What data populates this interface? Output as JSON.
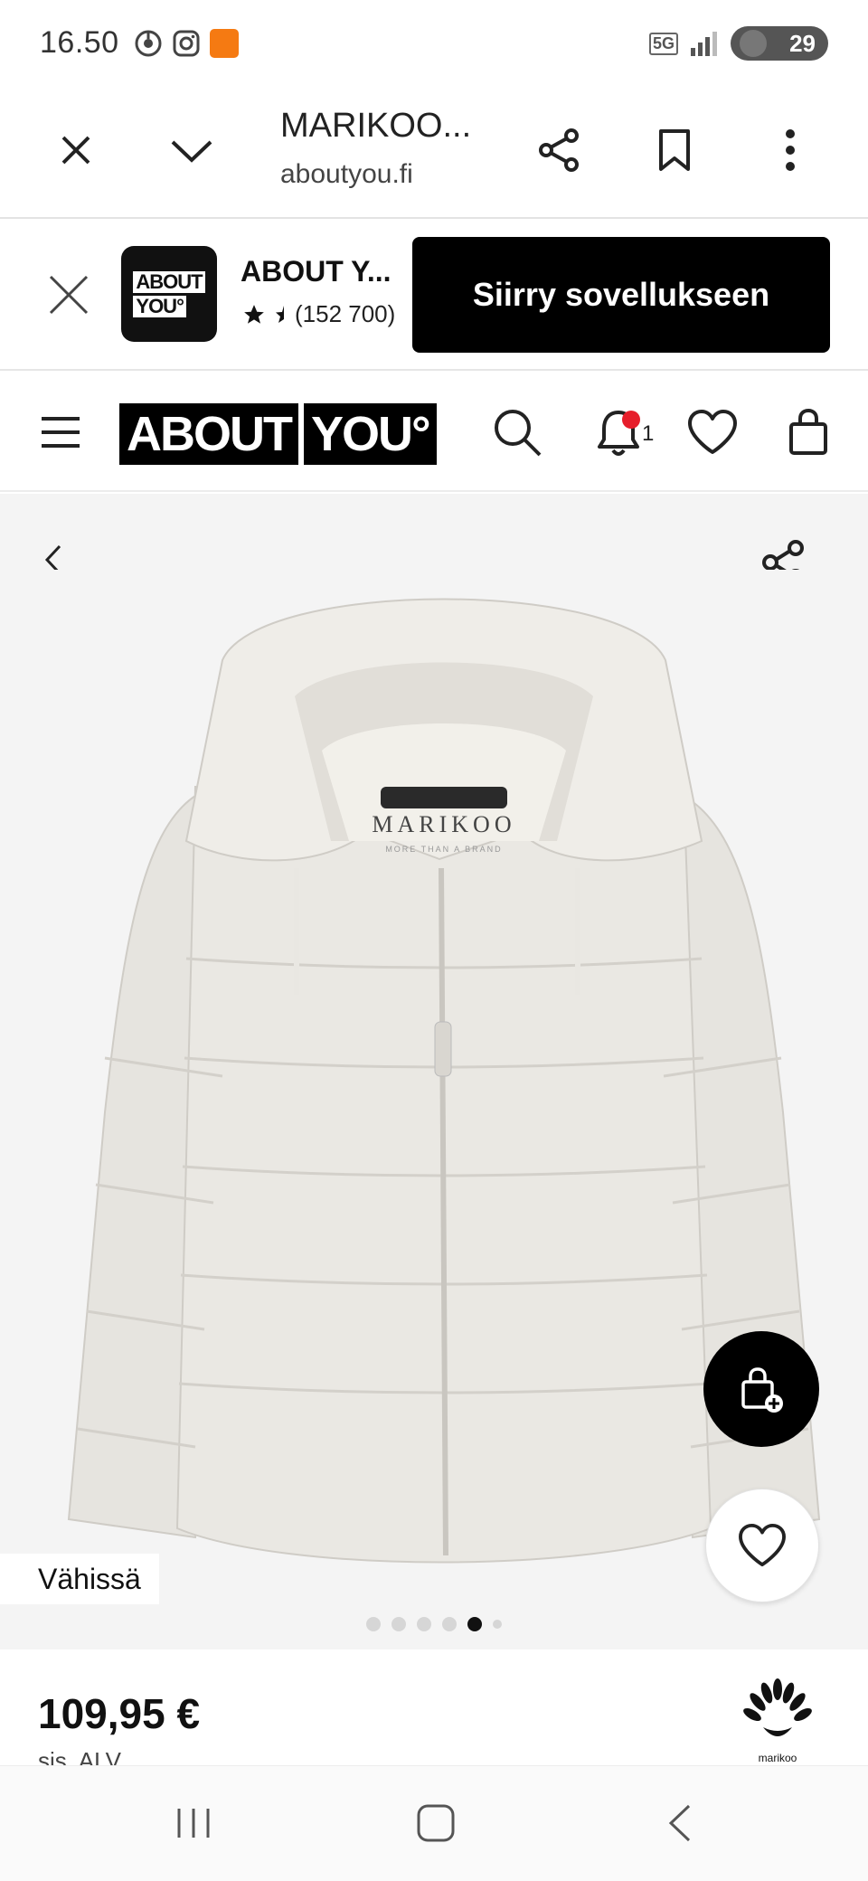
{
  "status_bar": {
    "time": "16.50",
    "network": "5G",
    "battery": "29",
    "notification_icons": [
      "chrome-icon",
      "instagram-icon",
      "temu-icon"
    ]
  },
  "browser": {
    "title": "MARIKOO...",
    "url": "aboutyou.fi"
  },
  "app_banner": {
    "app_name": "ABOUT Y...",
    "logo_line1": "ABOUT",
    "logo_line2": "YOU°",
    "rating_count": "(152 700)",
    "cta_label": "Siirry sovellukseen"
  },
  "site_header": {
    "logo_part1": "ABOUT",
    "logo_part2": "YOU°",
    "notification_count": "1"
  },
  "gallery": {
    "availability_label": "Vähissä",
    "image_count": 6,
    "active_image": 5,
    "jacket_label": "MARIKOO",
    "jacket_tagline": "MORE THAN A BRAND"
  },
  "product": {
    "price": "109,95 €",
    "vat_note": "sis. ALV",
    "brand_logo_text": "marikoo"
  },
  "colors": {
    "accent_black": "#000000",
    "badge_red": "#e61e2b",
    "gallery_bg": "#f4f4f4"
  }
}
